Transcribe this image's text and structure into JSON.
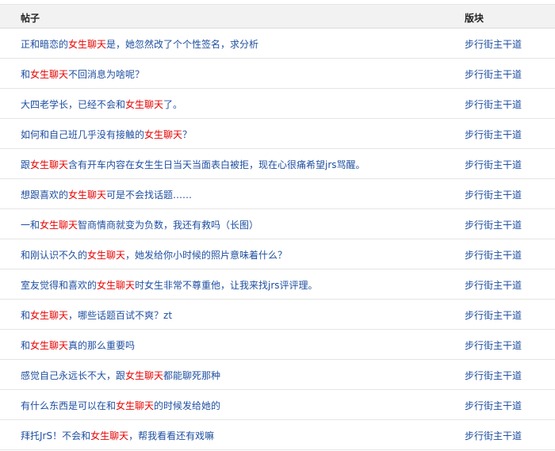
{
  "table": {
    "columns": {
      "title": "帖子",
      "board": "版块"
    },
    "highlight_keyword": "女生聊天",
    "rows": [
      {
        "title": "正和暗恋的女生聊天是，她忽然改了个个性签名，求分析",
        "board": "步行街主干道"
      },
      {
        "title": "和女生聊天不回消息为啥呢？",
        "board": "步行街主干道"
      },
      {
        "title": "大四老学长，已经不会和女生聊天了。",
        "board": "步行街主干道"
      },
      {
        "title": "如何和自己班几乎没有接触的女生聊天？",
        "board": "步行街主干道"
      },
      {
        "title": "跟女生聊天含有开车内容在女生生日当天当面表白被拒，现在心很痛希望jrs骂醒。",
        "board": "步行街主干道"
      },
      {
        "title": "想跟喜欢的女生聊天可是不会找话题……",
        "board": "步行街主干道"
      },
      {
        "title": "一和女生聊天智商情商就变为负数，我还有救吗（长图）",
        "board": "步行街主干道"
      },
      {
        "title": "和刚认识不久的女生聊天，她发给你小时候的照片意味着什么？",
        "board": "步行街主干道"
      },
      {
        "title": "室友觉得和喜欢的女生聊天时女生非常不尊重他，让我来找jrs评评理。",
        "board": "步行街主干道"
      },
      {
        "title": "和女生聊天，哪些话题百试不爽？zt",
        "board": "步行街主干道"
      },
      {
        "title": "和女生聊天真的那么重要吗",
        "board": "步行街主干道"
      },
      {
        "title": "感觉自己永远长不大，跟女生聊天都能聊死那种",
        "board": "步行街主干道"
      },
      {
        "title": "有什么东西是可以在和女生聊天的时候发给她的",
        "board": "步行街主干道"
      },
      {
        "title": "拜托JrS！不会和女生聊天，帮我看看还有戏嘛",
        "board": "步行街主干道"
      }
    ]
  }
}
